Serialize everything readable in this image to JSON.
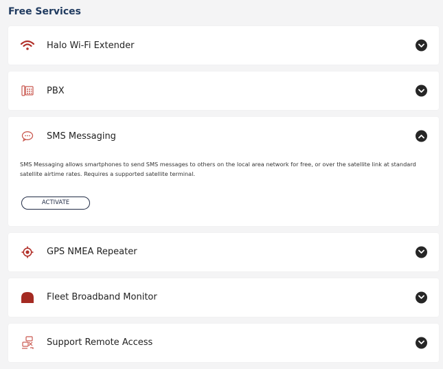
{
  "section": {
    "title": "Free Services"
  },
  "services": [
    {
      "name": "Halo Wi-Fi Extender",
      "icon": "wifi-icon",
      "expanded": false
    },
    {
      "name": "PBX",
      "icon": "pbx-phone-icon",
      "expanded": false
    },
    {
      "name": "SMS Messaging",
      "icon": "sms-bubble-icon",
      "expanded": true,
      "description": "SMS Messaging allows smartphones to send SMS messages to others on the local area network for free, or over the satellite link at standard satellite airtime rates. Requires a supported satellite terminal.",
      "action_label": "ACTIVATE"
    },
    {
      "name": "GPS NMEA Repeater",
      "icon": "gps-target-icon",
      "expanded": false
    },
    {
      "name": "Fleet Broadband Monitor",
      "icon": "fleet-broadband-icon",
      "expanded": false
    },
    {
      "name": "Support Remote Access",
      "icon": "remote-support-icon",
      "expanded": false
    }
  ],
  "colors": {
    "accent_red": "#b2312a",
    "title_blue": "#1f3a5f",
    "chevron_dark": "#262626"
  }
}
